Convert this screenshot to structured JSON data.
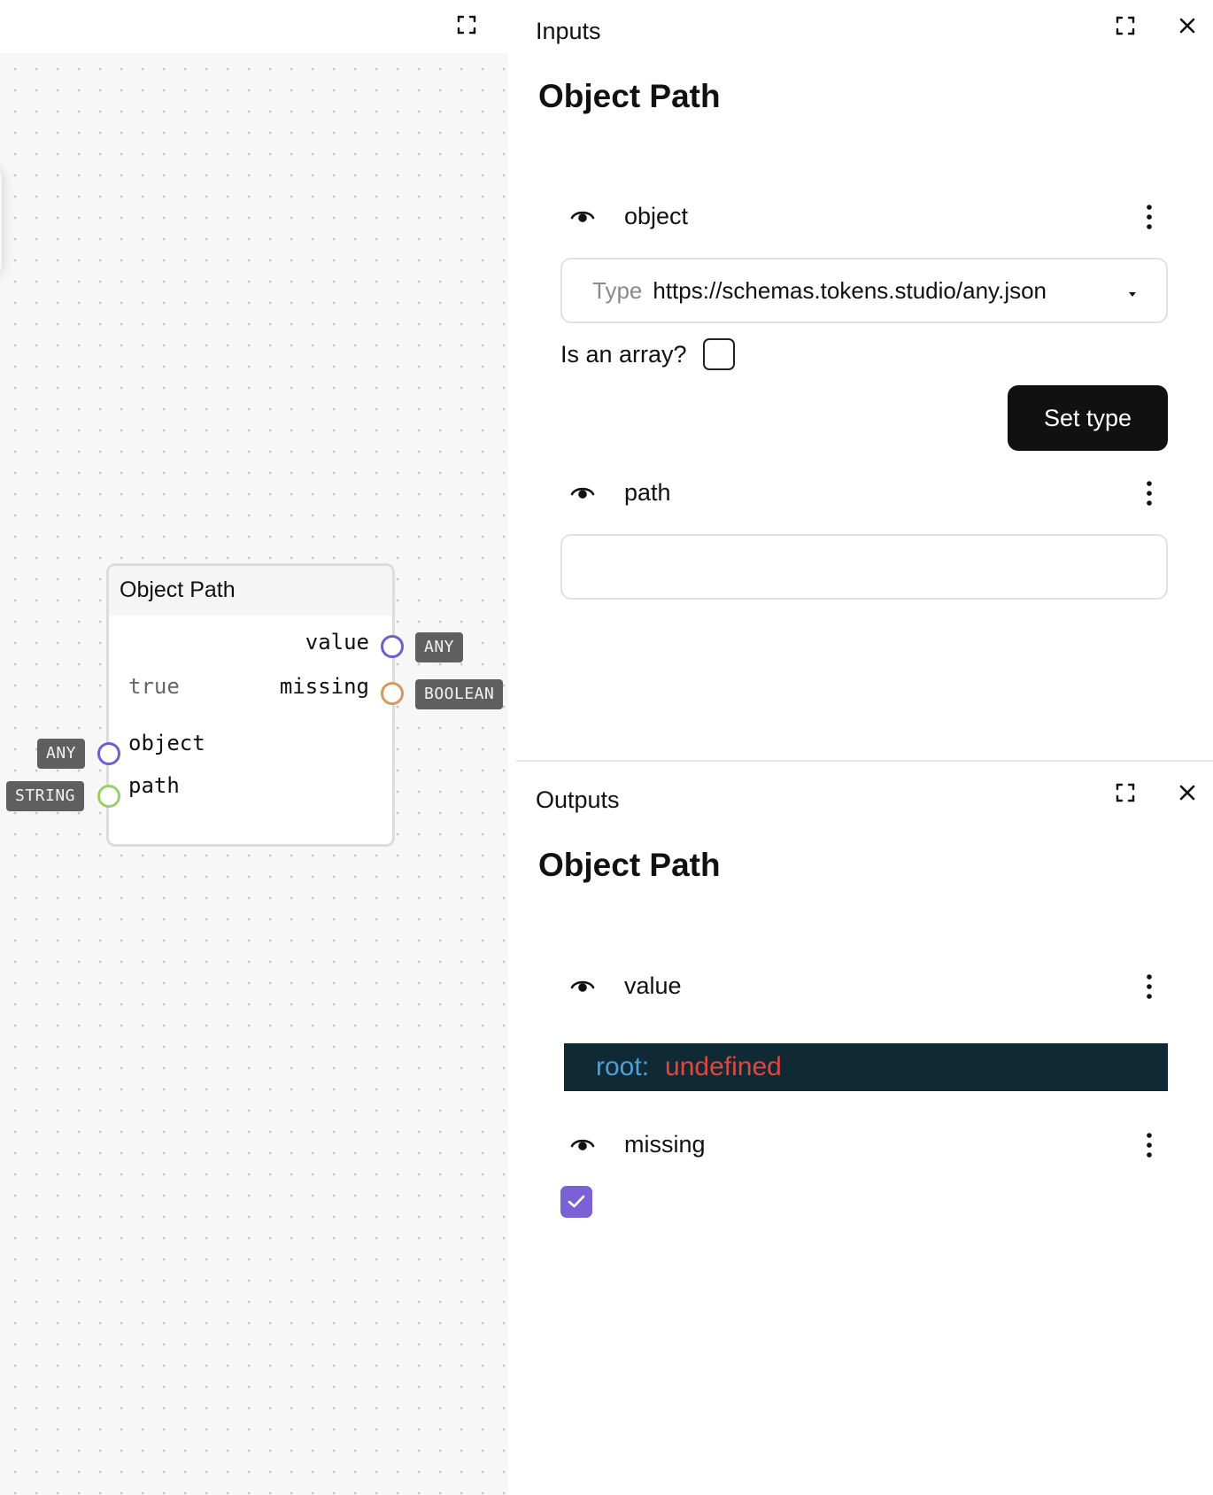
{
  "canvas": {
    "node": {
      "title": "Object Path",
      "outputs": [
        {
          "label": "value",
          "type": "ANY"
        },
        {
          "label": "missing",
          "type": "BOOLEAN",
          "current_value": "true"
        }
      ],
      "inputs": [
        {
          "label": "object",
          "type": "ANY"
        },
        {
          "label": "path",
          "type": "STRING"
        }
      ]
    }
  },
  "inputs_panel": {
    "title": "Inputs",
    "heading": "Object Path",
    "object_field": {
      "label": "object",
      "type_prefix": "Type",
      "type_value": "https://schemas.tokens.studio/any.json",
      "is_array_label": "Is an array?",
      "is_array_checked": false,
      "set_type_label": "Set type"
    },
    "path_field": {
      "label": "path",
      "value": "",
      "placeholder": ""
    }
  },
  "outputs_panel": {
    "title": "Outputs",
    "heading": "Object Path",
    "value_field": {
      "label": "value",
      "json_key": "root:",
      "json_value": "undefined"
    },
    "missing_field": {
      "label": "missing",
      "checked": true
    }
  },
  "colors": {
    "port_any": "#6c5fd0",
    "port_boolean": "#d39b5b",
    "port_string": "#9ccf63",
    "badge_bg": "#5f5f5f",
    "primary_button": "#111111",
    "checkbox_checked": "#7b61d6",
    "json_bg": "#0f2a35",
    "json_key": "#4f9fda",
    "json_value": "#e2463d"
  },
  "icons": [
    "fullscreen-icon",
    "close-icon",
    "eye-icon",
    "more-vertical-icon",
    "caret-down-icon",
    "check-icon"
  ]
}
